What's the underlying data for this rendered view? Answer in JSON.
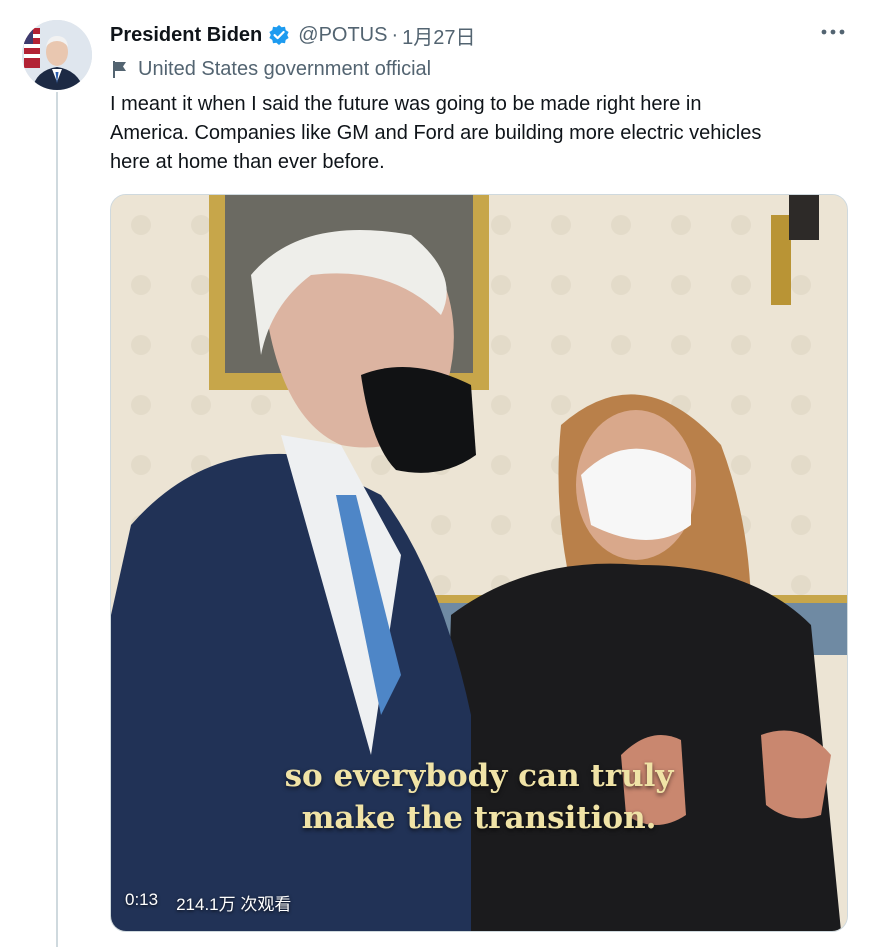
{
  "tweet": {
    "display_name": "President Biden",
    "handle": "@POTUS",
    "separator": "·",
    "date": "1月27日",
    "label": "United States government official",
    "text": "I meant it when I said the future was going to be made right here in\nAmerica. Companies like GM and Ford are building more electric vehicles\nhere at home than ever before."
  },
  "video": {
    "caption_line1": "so everybody can truly",
    "caption_line2": "make the transition.",
    "time": "0:13",
    "views": "214.1万 次观看"
  },
  "icons": {
    "verified": "verified-badge-icon",
    "flag": "flag-icon",
    "more": "more-icon"
  },
  "colors": {
    "verified": "#1d9bf0",
    "secondary_text": "#536471",
    "caption": "#f0e3a6"
  }
}
